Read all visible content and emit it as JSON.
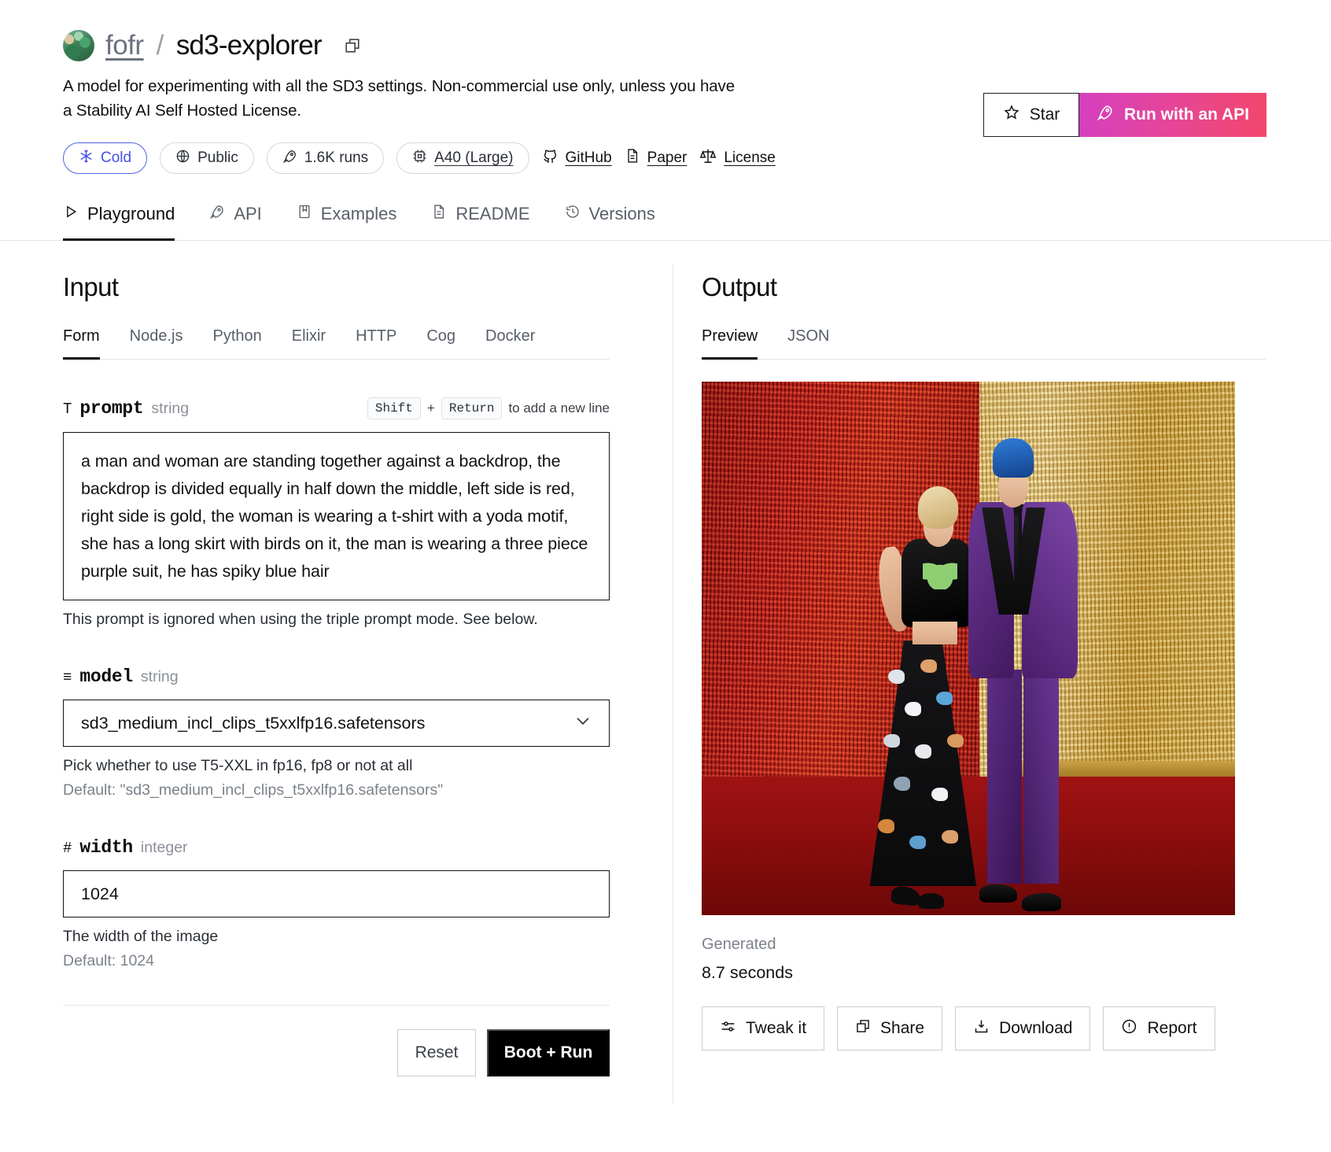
{
  "header": {
    "owner": "fofr",
    "separator": "/",
    "model_name": "sd3-explorer",
    "copy_icon": "copy-icon",
    "description": "A model for experimenting with all the SD3 settings. Non-commercial use only, unless you have a Stability AI Self Hosted License.",
    "badges": [
      {
        "icon": "snowflake-icon",
        "label": "Cold",
        "style": "cold"
      },
      {
        "icon": "globe-icon",
        "label": "Public",
        "style": "plain"
      },
      {
        "icon": "rocket-icon",
        "label": "1.6K runs",
        "style": "plain"
      },
      {
        "icon": "chip-icon",
        "label": "A40 (Large)",
        "style": "underline"
      }
    ],
    "links": [
      {
        "icon": "github-icon",
        "label": "GitHub"
      },
      {
        "icon": "paper-icon",
        "label": "Paper"
      },
      {
        "icon": "scales-icon",
        "label": "License"
      }
    ],
    "star_button": {
      "icon": "star-icon",
      "label": "Star"
    },
    "api_button": {
      "icon": "rocket-icon",
      "label": "Run with an API",
      "gradient_from": "#d43fbf",
      "gradient_to": "#f2476b"
    }
  },
  "nav_tabs": [
    {
      "icon": "play-icon",
      "label": "Playground",
      "active": true
    },
    {
      "icon": "rocket-icon",
      "label": "API",
      "active": false
    },
    {
      "icon": "book-icon",
      "label": "Examples",
      "active": false
    },
    {
      "icon": "doc-icon",
      "label": "README",
      "active": false
    },
    {
      "icon": "history-icon",
      "label": "Versions",
      "active": false
    }
  ],
  "input": {
    "title": "Input",
    "tabs": [
      {
        "label": "Form",
        "active": true
      },
      {
        "label": "Node.js",
        "active": false
      },
      {
        "label": "Python",
        "active": false
      },
      {
        "label": "Elixir",
        "active": false
      },
      {
        "label": "HTTP",
        "active": false
      },
      {
        "label": "Cog",
        "active": false
      },
      {
        "label": "Docker",
        "active": false
      }
    ],
    "fields": {
      "prompt": {
        "type_icon": "T",
        "name": "prompt",
        "type": "string",
        "hint_key1": "Shift",
        "hint_plus": "+",
        "hint_key2": "Return",
        "hint_tail": "to add a new line",
        "value": "a man and woman are standing together against a backdrop, the backdrop is divided equally in half down the middle, left side is red, right side is gold, the woman is wearing a t-shirt with a yoda motif, she has a long skirt with birds on it, the man is wearing a three piece purple suit, he has spiky blue hair",
        "helper": "This prompt is ignored when using the triple prompt mode. See below."
      },
      "model": {
        "type_icon": "≡",
        "name": "model",
        "type": "string",
        "value": "sd3_medium_incl_clips_t5xxlfp16.safetensors",
        "chevron": "chevron-down-icon",
        "helper": "Pick whether to use T5-XXL in fp16, fp8 or not at all",
        "default": "Default: \"sd3_medium_incl_clips_t5xxlfp16.safetensors\""
      },
      "width": {
        "type_icon": "#",
        "name": "width",
        "type": "integer",
        "value": "1024",
        "helper": "The width of the image",
        "default": "Default: 1024"
      }
    },
    "reset_label": "Reset",
    "run_label": "Boot + Run"
  },
  "output": {
    "title": "Output",
    "tabs": [
      {
        "label": "Preview",
        "active": true
      },
      {
        "label": "JSON",
        "active": false
      }
    ],
    "generated_label": "Generated",
    "duration": "8.7 seconds",
    "buttons": [
      {
        "icon": "sliders-icon",
        "label": "Tweak it"
      },
      {
        "icon": "copy-icon",
        "label": "Share"
      },
      {
        "icon": "download-icon",
        "label": "Download"
      },
      {
        "icon": "report-icon",
        "label": "Report"
      }
    ],
    "image_description": "A man and a woman standing together on a red carpet against a backdrop split half red sequin and half gold sequin; the woman wears a black yoda crop top and long black skirt with birds, the man wears a purple three-piece suit and has spiky blue hair."
  }
}
